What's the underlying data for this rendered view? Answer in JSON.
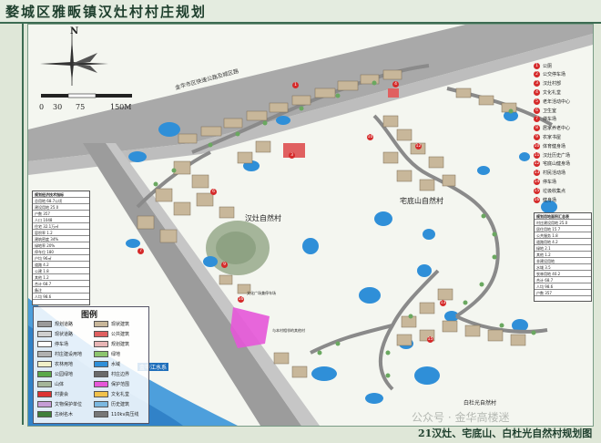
{
  "title": "婺城区雅畈镇汉灶村村庄规划",
  "caption": "21汉灶、宅底山、白杜光自然村规划图",
  "watermark": "公众号 · 金华高楼迷",
  "compass": {
    "north": "N"
  },
  "scale": {
    "ticks": [
      "0",
      "30",
      "75",
      "150M"
    ]
  },
  "map_labels": {
    "road_main": "金华市区快速公路及城区路",
    "village_handzao": "汉灶自然村",
    "village_zhaidi": "宅底山自然村",
    "village_baidu": "白杜光自然村",
    "river": "金华江水系",
    "plaza_note": "文化广场兼停车场",
    "plaza_note2": "与本村相邻的其他村"
  },
  "legend": {
    "title": "图例",
    "items": [
      {
        "label": "规划道路",
        "color": "#9a9a9a"
      },
      {
        "label": "现状建筑",
        "color": "#c8b79a"
      },
      {
        "label": "现状道路",
        "color": "#cfcfcf"
      },
      {
        "label": "公共建筑",
        "color": "#e06060"
      },
      {
        "label": "停车场",
        "color": "#ffffff"
      },
      {
        "label": "规划建筑",
        "color": "#e8b5b5"
      },
      {
        "label": "村庄建设用地",
        "color": "#b0b0b0"
      },
      {
        "label": "绿地",
        "color": "#8cc56e"
      },
      {
        "label": "农林用地",
        "color": "#f0f0c8"
      },
      {
        "label": "水域",
        "color": "#2f8fd8"
      },
      {
        "label": "公园绿地",
        "color": "#5aa84a"
      },
      {
        "label": "村庄边界",
        "color": "#6a6a6a"
      },
      {
        "label": "山体",
        "color": "#a5b59a"
      },
      {
        "label": "保护范围",
        "color": "#e657d8"
      },
      {
        "label": "村委会",
        "color": "#d33"
      },
      {
        "label": "文化礼堂",
        "color": "#f1c14b"
      },
      {
        "label": "文物保护单位",
        "color": "#c59cd6"
      },
      {
        "label": "历史建筑",
        "color": "#7bb8e0"
      },
      {
        "label": "古树名木",
        "color": "#3f7f3a"
      },
      {
        "label": "110kv高压线",
        "color": "#777"
      }
    ]
  },
  "facility_list": [
    {
      "n": "1",
      "label": "公厕"
    },
    {
      "n": "2",
      "label": "公交停车场"
    },
    {
      "n": "3",
      "label": "汉灶村部"
    },
    {
      "n": "4",
      "label": "文化礼堂"
    },
    {
      "n": "5",
      "label": "老年活动中心"
    },
    {
      "n": "6",
      "label": "卫生室"
    },
    {
      "n": "7",
      "label": "停车场"
    },
    {
      "n": "8",
      "label": "居家养老中心"
    },
    {
      "n": "9",
      "label": "农家书屋"
    },
    {
      "n": "10",
      "label": "体育健身场"
    },
    {
      "n": "11",
      "label": "汉灶历史广场"
    },
    {
      "n": "12",
      "label": "宅底山健身场"
    },
    {
      "n": "13",
      "label": "村民活动场"
    },
    {
      "n": "14",
      "label": "停车场"
    },
    {
      "n": "15",
      "label": "垃圾收集点"
    },
    {
      "n": "16",
      "label": "健身场"
    }
  ],
  "table_right": {
    "rows": [
      "规划用地面积汇总表",
      "村庄建设用地 25.0",
      "居住用地 15.7",
      "公共服务 1.8",
      "道路用地 4.2",
      "绿地 2.1",
      "其他 1.2",
      "非建设用地",
      "水域 3.5",
      "农林用地 40.2",
      "合计 68.7",
      "人均 98.6",
      "户数 357"
    ]
  },
  "table_left": {
    "rows": [
      "规划经济技术指标",
      "总用地 68.7公顷",
      "建设用地 25.0",
      "户数 357",
      "人口 1048",
      "住宅 32.1万㎡",
      "容积率 1.2",
      "建筑密度 34%",
      "绿地率 20%",
      "停车位 180",
      "户均 96㎡",
      "道路 4.2",
      "公建 1.8",
      "其他 1.2",
      "合计 68.7",
      "备注",
      "人均 98.6"
    ]
  }
}
